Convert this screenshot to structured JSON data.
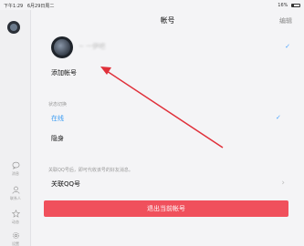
{
  "status_bar": {
    "time": "下午1:29",
    "date": "6月29日周二",
    "battery": "16%"
  },
  "header": {
    "title": "帐号",
    "edit_label": "编辑"
  },
  "account": {
    "name": "~ 一伊吧"
  },
  "add_account_label": "添加帐号",
  "status_section": {
    "label": "状态切换",
    "online": "在线",
    "invisible": "隐身"
  },
  "qq_section": {
    "hint": "关联QQ号后，即可代收该号的好友消息。",
    "label": "关联QQ号"
  },
  "logout_label": "退出当前帐号",
  "sidebar": {
    "items": [
      {
        "label": "消息",
        "icon": "chat-icon"
      },
      {
        "label": "联系人",
        "icon": "contacts-icon"
      },
      {
        "label": "动态",
        "icon": "star-icon"
      },
      {
        "label": "设置",
        "icon": "gear-icon"
      }
    ]
  },
  "colors": {
    "accent": "#3b9cf2",
    "logout": "#f0505c",
    "annotation_arrow": "#e0303a"
  }
}
